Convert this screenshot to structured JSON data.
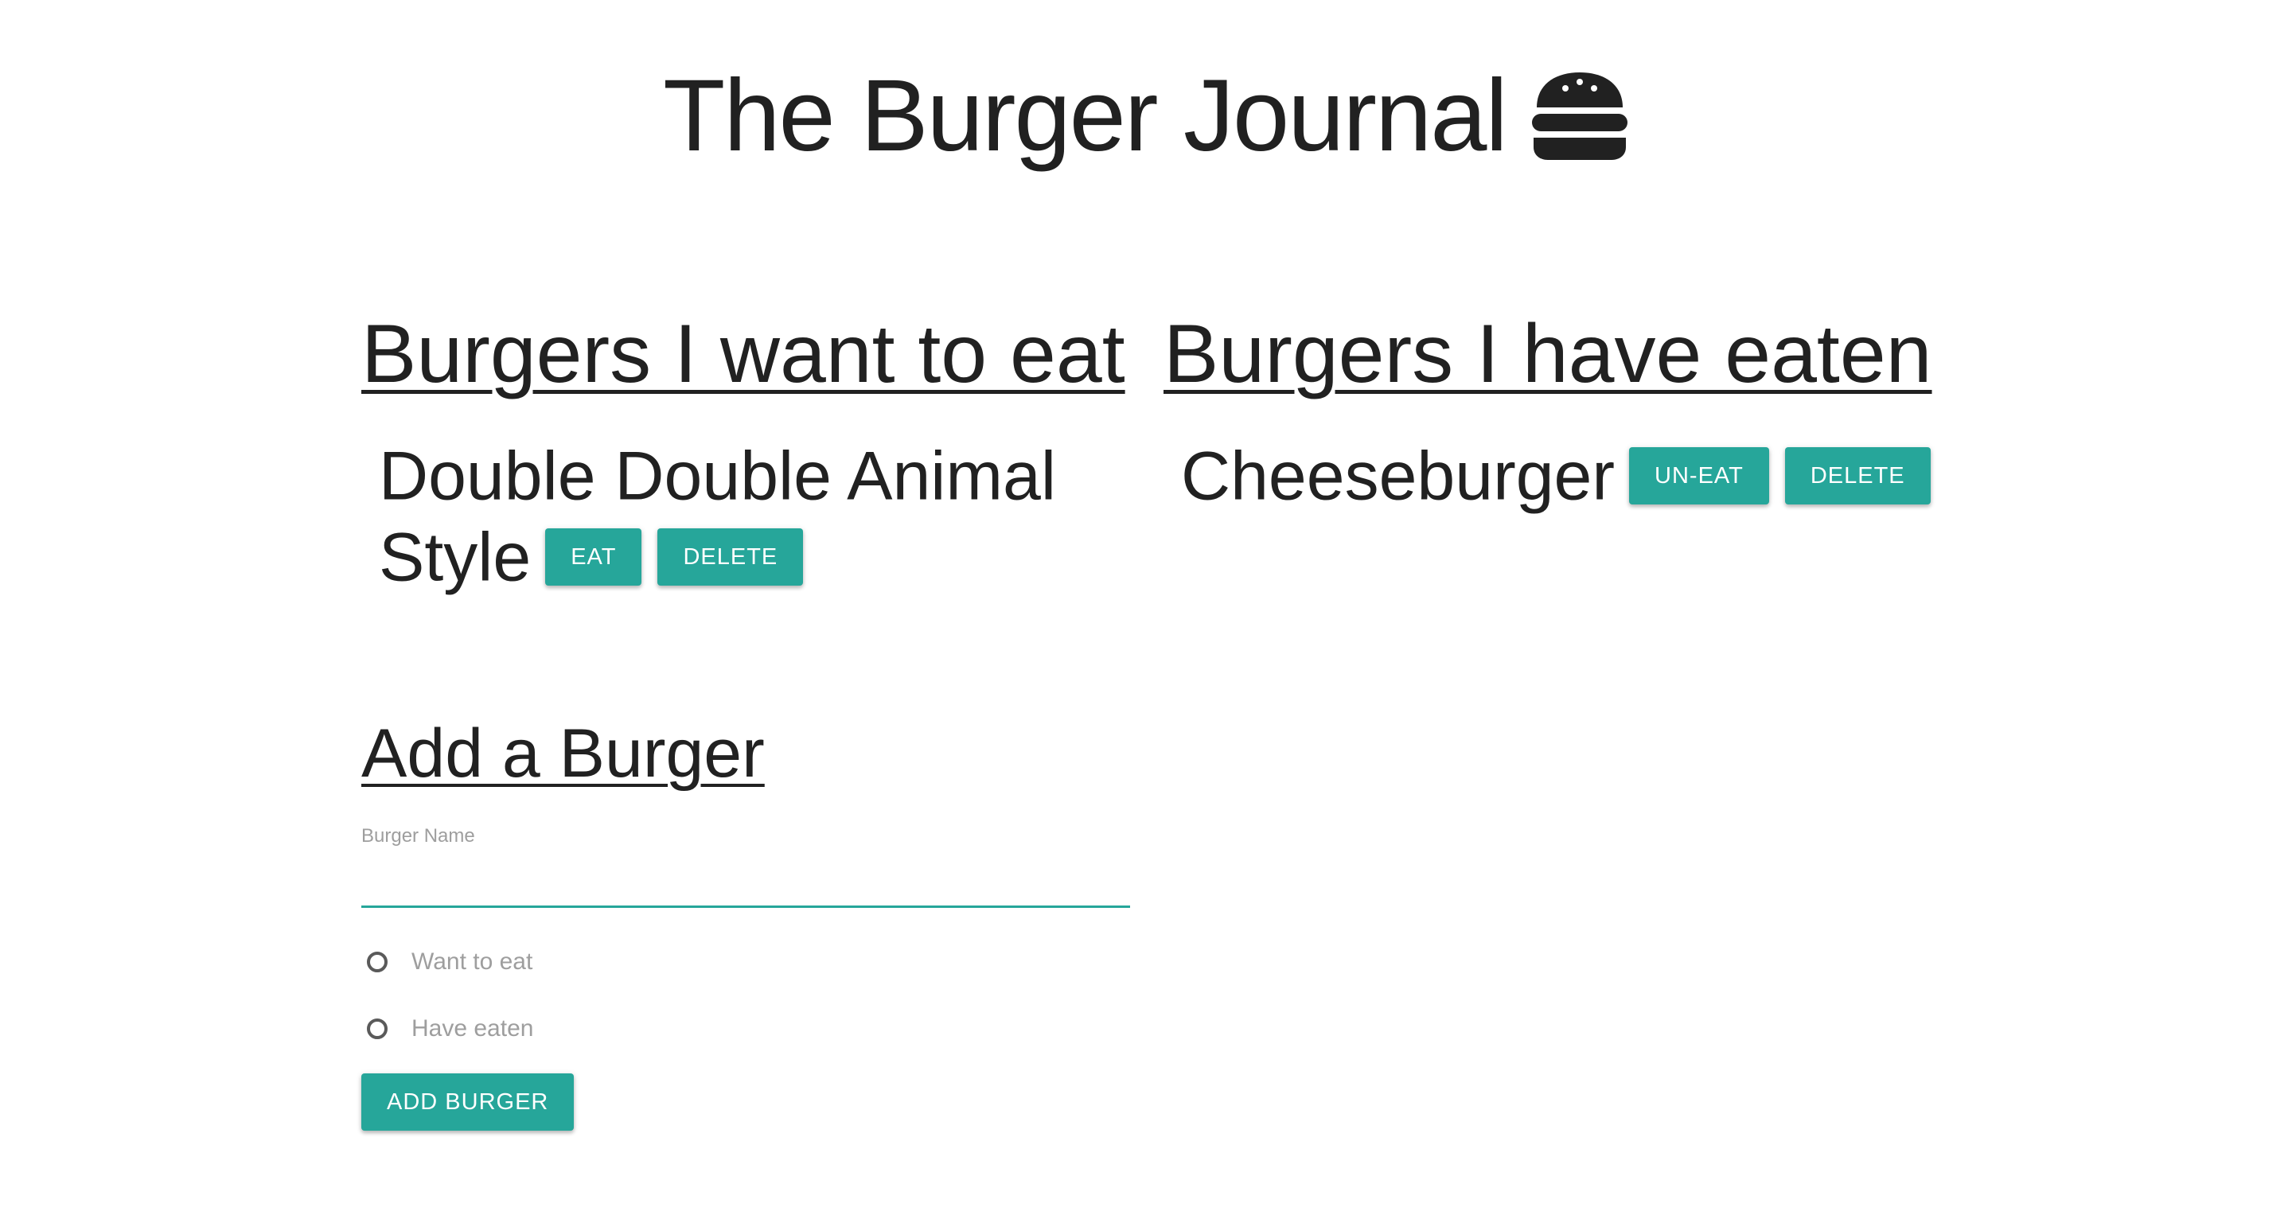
{
  "header": {
    "title": "The Burger Journal",
    "icon": "burger-icon"
  },
  "want_to_eat": {
    "heading": "Burgers I want to eat",
    "items": [
      {
        "name": "Double Double Animal Style",
        "primary_action": "EAT",
        "delete_action": "DELETE"
      }
    ]
  },
  "have_eaten": {
    "heading": "Burgers I have eaten",
    "items": [
      {
        "name": "Cheeseburger",
        "primary_action": "UN-EAT",
        "delete_action": "DELETE"
      }
    ]
  },
  "add_form": {
    "heading": "Add a Burger",
    "name_label": "Burger Name",
    "name_value": "",
    "options": [
      "Want to eat",
      "Have eaten"
    ],
    "submit_label": "ADD BURGER"
  },
  "colors": {
    "accent": "#26a69a",
    "text": "#212121",
    "muted": "#9e9e9e"
  }
}
